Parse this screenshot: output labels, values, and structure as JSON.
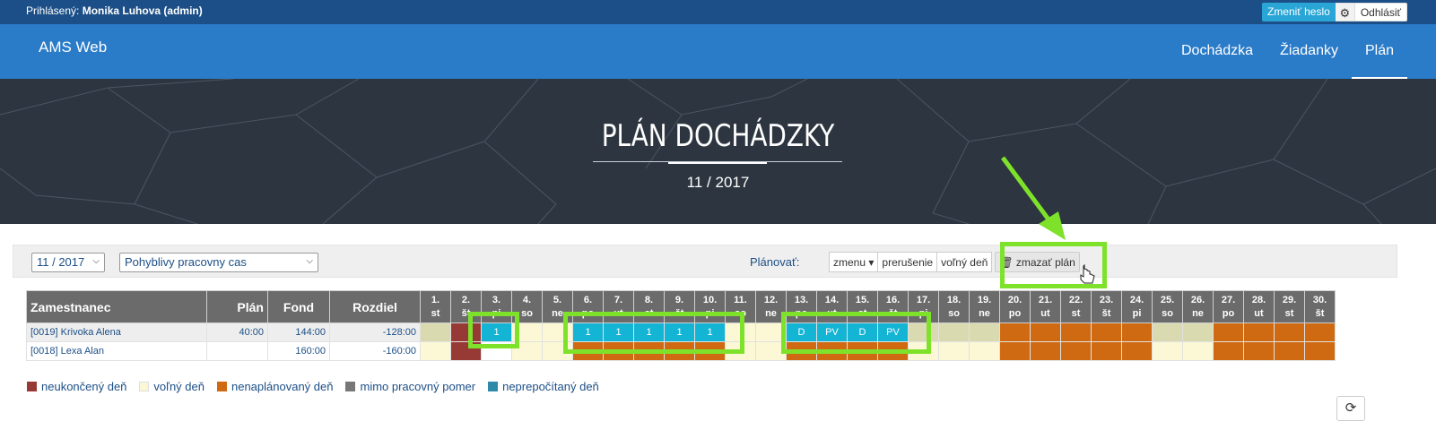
{
  "topbar": {
    "login_prefix": "Prihlásený:",
    "login_user": "Monika Luhova (admin)",
    "change_password": "Zmeniť heslo",
    "logout": "Odhlásiť"
  },
  "nav": {
    "brand": "AMS Web",
    "links": [
      "Dochádzka",
      "Žiadanky",
      "Plán"
    ],
    "active": "Plán"
  },
  "hero": {
    "title": "PLÁN DOCHÁDZKY",
    "subtitle": "11 / 2017"
  },
  "filters": {
    "month_value": "11 / 2017",
    "worktime_value": "Pohyblivy pracovny cas",
    "plan_label": "Plánovať:",
    "buttons": [
      "zmenu",
      "prerušenie",
      "voľný deň",
      "zmazať plán"
    ]
  },
  "table": {
    "headers": {
      "employee": "Zamestnanec",
      "plan": "Plán",
      "fund": "Fond",
      "diff": "Rozdiel"
    },
    "days": [
      {
        "n": "1.",
        "d": "st"
      },
      {
        "n": "2.",
        "d": "št"
      },
      {
        "n": "3.",
        "d": "pi"
      },
      {
        "n": "4.",
        "d": "so"
      },
      {
        "n": "5.",
        "d": "ne"
      },
      {
        "n": "6.",
        "d": "po"
      },
      {
        "n": "7.",
        "d": "ut"
      },
      {
        "n": "8.",
        "d": "st"
      },
      {
        "n": "9.",
        "d": "št"
      },
      {
        "n": "10.",
        "d": "pi"
      },
      {
        "n": "11.",
        "d": "so"
      },
      {
        "n": "12.",
        "d": "ne"
      },
      {
        "n": "13.",
        "d": "po"
      },
      {
        "n": "14.",
        "d": "ut"
      },
      {
        "n": "15.",
        "d": "st"
      },
      {
        "n": "16.",
        "d": "št"
      },
      {
        "n": "17.",
        "d": "pi"
      },
      {
        "n": "18.",
        "d": "so"
      },
      {
        "n": "19.",
        "d": "ne"
      },
      {
        "n": "20.",
        "d": "po"
      },
      {
        "n": "21.",
        "d": "ut"
      },
      {
        "n": "22.",
        "d": "st"
      },
      {
        "n": "23.",
        "d": "št"
      },
      {
        "n": "24.",
        "d": "pi"
      },
      {
        "n": "25.",
        "d": "so"
      },
      {
        "n": "26.",
        "d": "ne"
      },
      {
        "n": "27.",
        "d": "po"
      },
      {
        "n": "28.",
        "d": "ut"
      },
      {
        "n": "29.",
        "d": "st"
      },
      {
        "n": "30.",
        "d": "št"
      }
    ],
    "rows": [
      {
        "name": "[0019] Krivoka Alena",
        "plan": "40:00",
        "fund": "144:00",
        "diff": "-128:00",
        "cells": [
          {
            "c": "out",
            "t": ""
          },
          {
            "c": "un",
            "t": ""
          },
          {
            "c": "pl",
            "t": "1"
          },
          {
            "c": "fr",
            "t": ""
          },
          {
            "c": "fr",
            "t": ""
          },
          {
            "c": "pl",
            "t": "1"
          },
          {
            "c": "pl",
            "t": "1"
          },
          {
            "c": "pl",
            "t": "1"
          },
          {
            "c": "pl",
            "t": "1"
          },
          {
            "c": "pl",
            "t": "1"
          },
          {
            "c": "fr",
            "t": ""
          },
          {
            "c": "fr",
            "t": ""
          },
          {
            "c": "pl",
            "t": "D"
          },
          {
            "c": "pl",
            "t": "PV"
          },
          {
            "c": "pl",
            "t": "D"
          },
          {
            "c": "pl",
            "t": "PV"
          },
          {
            "c": "out",
            "t": ""
          },
          {
            "c": "out",
            "t": ""
          },
          {
            "c": "out",
            "t": ""
          },
          {
            "c": "np",
            "t": ""
          },
          {
            "c": "np",
            "t": ""
          },
          {
            "c": "np",
            "t": ""
          },
          {
            "c": "np",
            "t": ""
          },
          {
            "c": "np",
            "t": ""
          },
          {
            "c": "out",
            "t": ""
          },
          {
            "c": "out",
            "t": ""
          },
          {
            "c": "np",
            "t": ""
          },
          {
            "c": "np",
            "t": ""
          },
          {
            "c": "np",
            "t": ""
          },
          {
            "c": "np",
            "t": ""
          }
        ]
      },
      {
        "name": "[0018] Lexa Alan",
        "plan": "",
        "fund": "160:00",
        "diff": "-160:00",
        "cells": [
          {
            "c": "fr",
            "t": ""
          },
          {
            "c": "un",
            "t": ""
          },
          {
            "c": "w",
            "t": ""
          },
          {
            "c": "fr",
            "t": ""
          },
          {
            "c": "fr",
            "t": ""
          },
          {
            "c": "np",
            "t": ""
          },
          {
            "c": "np",
            "t": ""
          },
          {
            "c": "np",
            "t": ""
          },
          {
            "c": "np",
            "t": ""
          },
          {
            "c": "np",
            "t": ""
          },
          {
            "c": "fr",
            "t": ""
          },
          {
            "c": "fr",
            "t": ""
          },
          {
            "c": "np",
            "t": ""
          },
          {
            "c": "np",
            "t": ""
          },
          {
            "c": "np",
            "t": ""
          },
          {
            "c": "np",
            "t": ""
          },
          {
            "c": "fr",
            "t": ""
          },
          {
            "c": "fr",
            "t": ""
          },
          {
            "c": "fr",
            "t": ""
          },
          {
            "c": "np",
            "t": ""
          },
          {
            "c": "np",
            "t": ""
          },
          {
            "c": "np",
            "t": ""
          },
          {
            "c": "np",
            "t": ""
          },
          {
            "c": "np",
            "t": ""
          },
          {
            "c": "fr",
            "t": ""
          },
          {
            "c": "fr",
            "t": ""
          },
          {
            "c": "np",
            "t": ""
          },
          {
            "c": "np",
            "t": ""
          },
          {
            "c": "np",
            "t": ""
          },
          {
            "c": "np",
            "t": ""
          }
        ]
      }
    ]
  },
  "legend": [
    {
      "label": "neukončený deň",
      "color": "#973a36"
    },
    {
      "label": "voľný deň",
      "color": "#fcf8d5"
    },
    {
      "label": "nenaplánovaný deň",
      "color": "#cf6a12"
    },
    {
      "label": "mimo pracovný pomer",
      "color": "#777777"
    },
    {
      "label": "neprepočítaný deň",
      "color": "#2e8aa8"
    }
  ],
  "colors": {
    "annotation": "#7ee22a",
    "accent": "#2a7bc8",
    "planned": "#14b4d5"
  },
  "icons": {
    "settings": "gear-icon",
    "delete": "trash-icon",
    "refresh": "refresh-icon",
    "cursor": "hand-cursor-icon"
  }
}
